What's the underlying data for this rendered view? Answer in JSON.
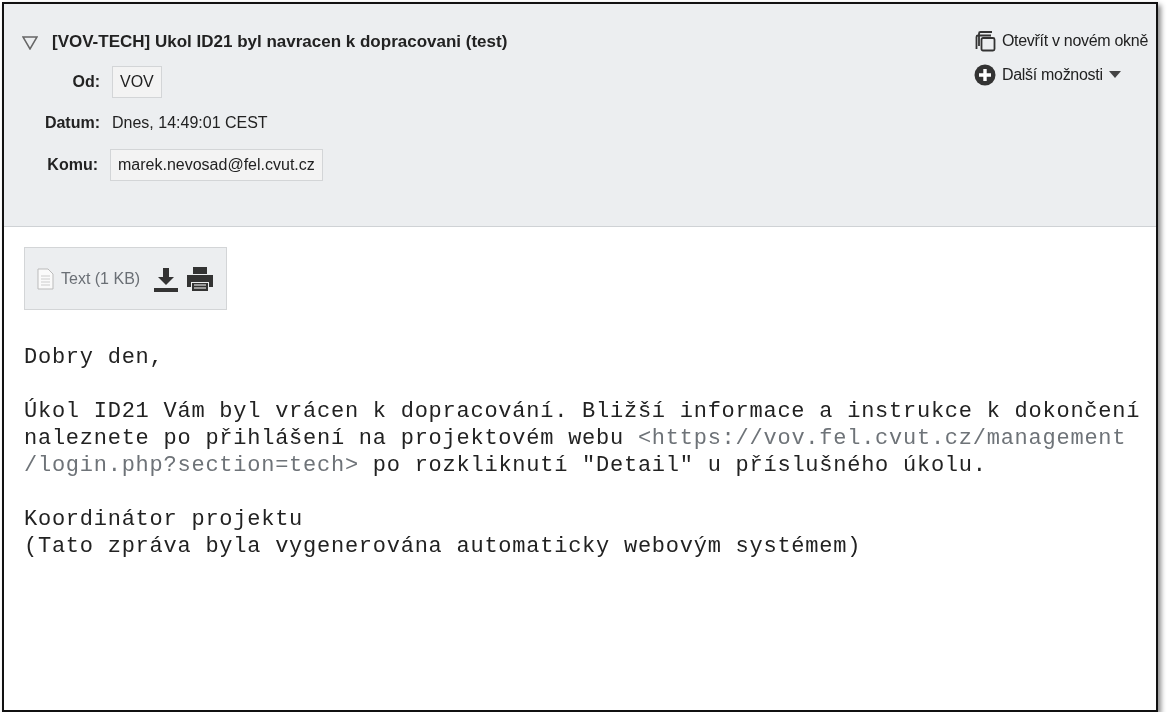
{
  "header": {
    "subject": "[VOV-TECH] Ukol ID21 byl navracen k dopracovani (test)",
    "expanded": true,
    "fields": [
      {
        "label": "Od:",
        "value": "VOV",
        "kind": "chip"
      },
      {
        "label": "Datum:",
        "value": "Dnes, 14:49:01 CEST",
        "kind": "plain"
      },
      {
        "label": "Komu:",
        "value": "marek.nevosad@fel.cvut.cz",
        "kind": "chip"
      }
    ],
    "actions": [
      {
        "label": "Otevřít v novém okně",
        "kind": "window"
      },
      {
        "label": "Další možnosti",
        "kind": "more"
      }
    ]
  },
  "attachment": {
    "label": "Text (1 KB)"
  },
  "body": [
    [
      {
        "kind": "text",
        "text": "Dobry den,"
      }
    ],
    [
      {
        "kind": "text",
        "text": "Úkol ID21 Vám byl vrácen k dopracování. Bližší informace a instrukce k dokončení naleznete po přihlášení na projektovém webu "
      },
      {
        "kind": "link",
        "text": "<https://vov.fel.cvut.cz/management"
      },
      {
        "kind": "link",
        "text": "/login.php?section=tech>"
      },
      {
        "kind": "text",
        "text": " po rozkliknutí \"Detail\" u příslušného úkolu."
      }
    ],
    [
      {
        "kind": "text",
        "text": "Koordinátor projektu"
      },
      {
        "kind": "break"
      },
      {
        "kind": "text",
        "text": "(Tato zpráva byla vygenerována automaticky webovým systémem)"
      }
    ]
  ]
}
